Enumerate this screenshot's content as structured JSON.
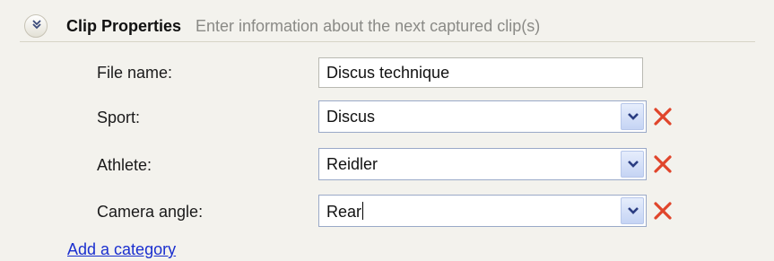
{
  "header": {
    "title": "Clip Properties",
    "description": "Enter information about the next captured clip(s)"
  },
  "fields": {
    "file_name": {
      "label": "File name:",
      "value": "Discus technique"
    },
    "sport": {
      "label": "Sport:",
      "value": "Discus"
    },
    "athlete": {
      "label": "Athlete:",
      "value": "Reidler"
    },
    "camera_angle": {
      "label": "Camera angle:",
      "value": "Rear"
    }
  },
  "links": {
    "add_category": "Add a category"
  },
  "icons": {
    "collapse": "double-chevron-up-icon",
    "dropdown": "chevron-down-icon",
    "delete": "red-x-icon"
  },
  "colors": {
    "link": "#1a2fcf",
    "delete": "#e0452b",
    "combo_arrow_start": "#e6edfc",
    "combo_arrow_end": "#c5d4f4"
  }
}
